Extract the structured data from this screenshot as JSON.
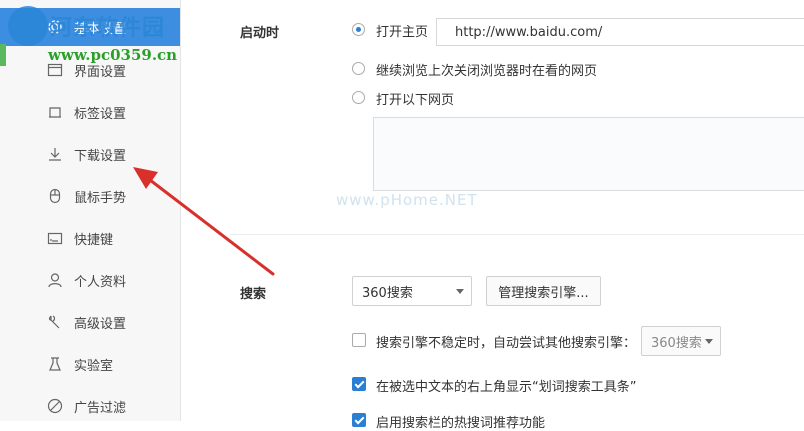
{
  "sidebar": {
    "items": [
      {
        "label": "基本设置",
        "icon": "gear-icon"
      },
      {
        "label": "界面设置",
        "icon": "window-icon"
      },
      {
        "label": "标签设置",
        "icon": "tab-icon"
      },
      {
        "label": "下载设置",
        "icon": "download-icon"
      },
      {
        "label": "鼠标手势",
        "icon": "mouse-icon"
      },
      {
        "label": "快捷键",
        "icon": "keyboard-icon"
      },
      {
        "label": "个人资料",
        "icon": "person-icon"
      },
      {
        "label": "高级设置",
        "icon": "wrench-icon"
      },
      {
        "label": "实验室",
        "icon": "flask-icon"
      },
      {
        "label": "广告过滤",
        "icon": "block-icon"
      }
    ]
  },
  "watermark": {
    "site_name": "河东软件园",
    "site_url": "www.pc0359.cn",
    "mid_text": "www.pHome.NET"
  },
  "startup": {
    "label": "启动时",
    "options": [
      "打开主页",
      "继续浏览上次关闭浏览器时在看的网页",
      "打开以下网页"
    ],
    "homepage_url": "http://www.baidu.com/"
  },
  "search": {
    "label": "搜索",
    "engine": "360搜索",
    "manage_button": "管理搜索引擎...",
    "fallback_text": "搜索引擎不稳定时，自动尝试其他搜索引擎：",
    "fallback_engine": "360搜索",
    "toolbar_text": "在被选中文本的右上角显示“划词搜索工具条”",
    "partial_text": "启用搜索栏的热搜词推荐功能"
  },
  "colors": {
    "accent": "#3d8ee0",
    "arrow": "#d9302c"
  }
}
